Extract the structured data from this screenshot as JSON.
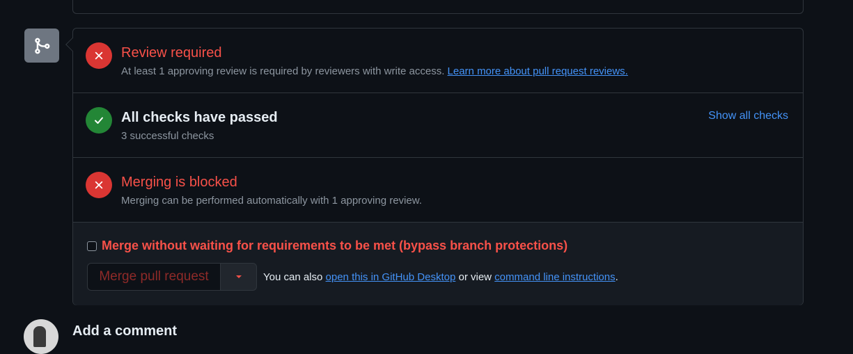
{
  "review": {
    "title": "Review required",
    "desc": "At least 1 approving review is required by reviewers with write access.",
    "link": "Learn more about pull request reviews."
  },
  "checks": {
    "title": "All checks have passed",
    "desc": "3 successful checks",
    "show_all": "Show all checks"
  },
  "blocked": {
    "title": "Merging is blocked",
    "desc": "Merging can be performed automatically with 1 approving review."
  },
  "bypass": {
    "label": "Merge without waiting for requirements to be met (bypass branch protections)"
  },
  "merge": {
    "button_label": "Merge pull request",
    "also_prefix": "You can also",
    "desktop_link": "open this in GitHub Desktop",
    "or_view": "or view",
    "cli_link": "command line instructions",
    "suffix": "."
  },
  "comment": {
    "title": "Add a comment"
  },
  "colors": {
    "error": "#f85149",
    "success": "#238636",
    "link": "#4493f8"
  },
  "icons": [
    "git-merge-icon",
    "x-icon",
    "check-icon",
    "triangle-down-icon"
  ]
}
